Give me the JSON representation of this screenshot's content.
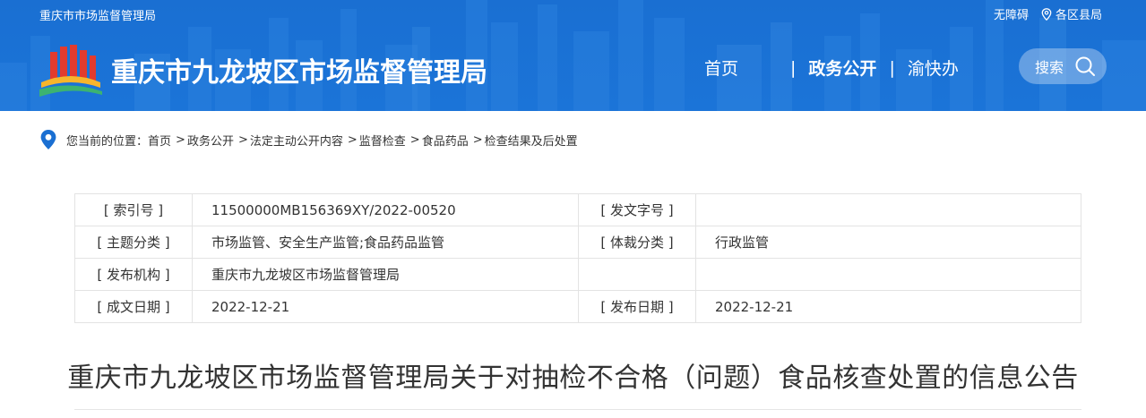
{
  "header": {
    "top_left_link": "重庆市市场监督管理局",
    "accessibility": "无障碍",
    "district_bureaus": "各区县局",
    "site_title": "重庆市九龙坡区市场监督管理局",
    "nav": {
      "home": "首页",
      "sep1": "|",
      "gov_affairs": "政务公开",
      "sep2": "|",
      "yukuaiban": "渝快办"
    },
    "search_label": "搜索"
  },
  "breadcrumb": {
    "prefix": "您当前的位置：",
    "items": [
      "首页",
      "政务公开",
      "法定主动公开内容",
      "监督检查",
      "食品药品",
      "检查结果及后处置"
    ],
    "arrow": ">"
  },
  "info_table": {
    "rows": [
      {
        "label1": "[ 索引号 ]",
        "value1": "11500000MB156369XY/2022-00520",
        "label2": "[ 发文字号 ]",
        "value2": ""
      },
      {
        "label1": "[ 主题分类 ]",
        "value1": "市场监管、安全生产监管;食品药品监管",
        "label2": "[ 体裁分类 ]",
        "value2": "行政监管"
      },
      {
        "label1": "[ 发布机构 ]",
        "value1": "重庆市九龙坡区市场监督管理局",
        "label2": "",
        "value2": ""
      },
      {
        "label1": "[ 成文日期 ]",
        "value1": "2022-12-21",
        "label2": "[ 发布日期 ]",
        "value2": "2022-12-21"
      }
    ]
  },
  "article": {
    "title": "重庆市九龙坡区市场监督管理局关于对抽检不合格（问题）食品核查处置的信息公告"
  },
  "colors": {
    "header_blue": "#1b72d6",
    "accent_blue": "#1a6fd2",
    "logo_red": "#e23b2e",
    "logo_yellow": "#f7b52c"
  },
  "icons": {
    "location": "location-pin-icon",
    "search": "search-icon",
    "breadcrumb": "map-pin-icon",
    "logo": "emblem-logo"
  }
}
